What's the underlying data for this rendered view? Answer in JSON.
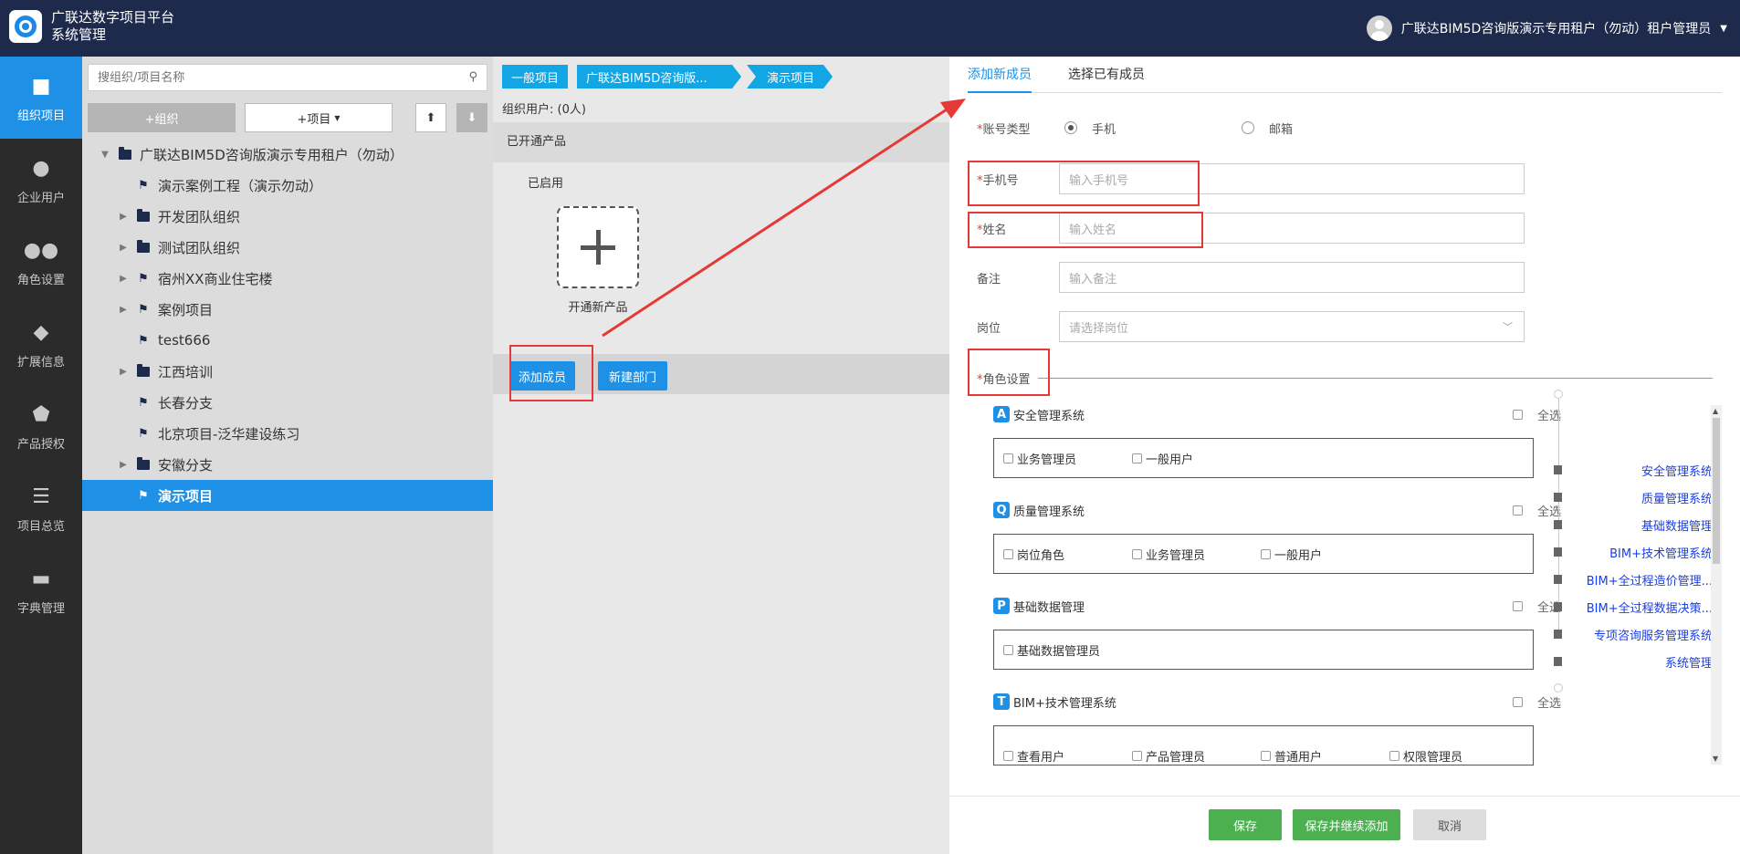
{
  "header": {
    "app_title_line1": "广联达数字项目平台",
    "app_title_line2": "系统管理",
    "user_name": "广联达BIM5D咨询版演示专用租户（勿动）租户管理员"
  },
  "leftnav": [
    {
      "label": "组织项目",
      "icon": "folder-icon"
    },
    {
      "label": "企业用户",
      "icon": "user-icon"
    },
    {
      "label": "角色设置",
      "icon": "users-icon"
    },
    {
      "label": "扩展信息",
      "icon": "tag-icon"
    },
    {
      "label": "产品授权",
      "icon": "shield-icon"
    },
    {
      "label": "项目总览",
      "icon": "list-icon"
    },
    {
      "label": "字典管理",
      "icon": "book-icon"
    }
  ],
  "tree_panel": {
    "search_placeholder": "搜组织/项目名称",
    "add_org_label": "+组织",
    "add_project_label": "+项目",
    "items": [
      {
        "label": "广联达BIM5D咨询版演示专用租户（勿动）",
        "type": "folder",
        "expandable": true,
        "level": 0
      },
      {
        "label": "演示案例工程（演示勿动）",
        "type": "project",
        "expandable": false,
        "level": 1
      },
      {
        "label": "开发团队组织",
        "type": "folder",
        "expandable": true,
        "level": 1
      },
      {
        "label": "测试团队组织",
        "type": "folder",
        "expandable": true,
        "level": 1
      },
      {
        "label": "宿州XX商业住宅楼",
        "type": "project",
        "expandable": true,
        "level": 1
      },
      {
        "label": "案例项目",
        "type": "folder",
        "expandable": true,
        "level": 1
      },
      {
        "label": "test666",
        "type": "project",
        "expandable": false,
        "level": 1
      },
      {
        "label": "江西培训",
        "type": "folder",
        "expandable": true,
        "level": 1
      },
      {
        "label": "长春分支",
        "type": "project",
        "expandable": false,
        "level": 1
      },
      {
        "label": "北京项目-泛华建设练习",
        "type": "project",
        "expandable": false,
        "level": 1
      },
      {
        "label": "安徽分支",
        "type": "folder",
        "expandable": true,
        "level": 1
      },
      {
        "label": "演示项目",
        "type": "project",
        "expandable": false,
        "level": 1,
        "selected": true
      }
    ]
  },
  "mid_panel": {
    "breadcrumbs": [
      "一般项目",
      "广联达BIM5D咨询版...",
      "演示项目"
    ],
    "org_users": "组织用户: (0人)",
    "opened_products": "已开通产品",
    "enabled": "已启用",
    "new_product": "开通新产品",
    "add_member": "添加成员",
    "new_dept": "新建部门"
  },
  "right_panel": {
    "tabs": [
      "添加新成员",
      "选择已有成员"
    ],
    "account_type_label": "账号类型",
    "account_type_options": [
      "手机",
      "邮箱"
    ],
    "phone_label": "手机号",
    "phone_placeholder": "输入手机号",
    "name_label": "姓名",
    "name_placeholder": "输入姓名",
    "remark_label": "备注",
    "remark_placeholder": "输入备注",
    "post_label": "岗位",
    "post_placeholder": "请选择岗位",
    "role_settings_label": "角色设置",
    "select_all": "全选",
    "systems": [
      {
        "name": "安全管理系统",
        "icon": "A",
        "roles": [
          "业务管理员",
          "一般用户"
        ]
      },
      {
        "name": "质量管理系统",
        "icon": "Q",
        "roles": [
          "岗位角色",
          "业务管理员",
          "一般用户"
        ]
      },
      {
        "name": "基础数据管理",
        "icon": "P",
        "roles": [
          "基础数据管理员"
        ]
      },
      {
        "name": "BIM+技术管理系统",
        "icon": "T",
        "roles": [
          "查看用户",
          "产品管理员",
          "普通用户",
          "权限管理员"
        ]
      }
    ],
    "anchors": [
      "安全管理系统",
      "质量管理系统",
      "基础数据管理",
      "BIM+技术管理系统",
      "BIM+全过程造价管理...",
      "BIM+全过程数据决策...",
      "专项咨询服务管理系统",
      "系统管理"
    ],
    "save": "保存",
    "save_continue": "保存并继续添加",
    "cancel": "取消"
  },
  "colors": {
    "header_bg": "#1d2a4c",
    "accent": "#1e90e6",
    "breadcrumb": "#12a6e4",
    "save_green": "#4caf50",
    "annotation_red": "#e53935"
  }
}
